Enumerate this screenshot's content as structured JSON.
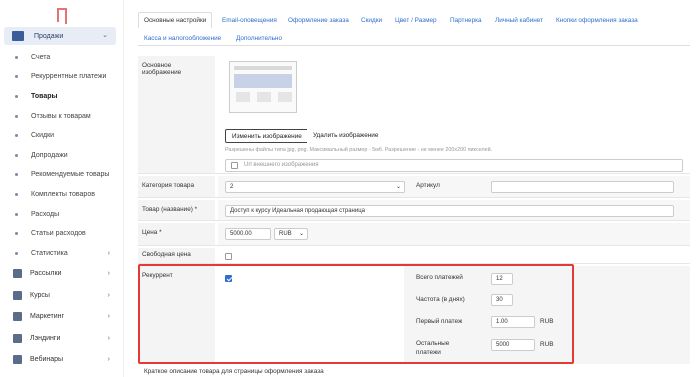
{
  "sidebar": {
    "main_item": {
      "label": "Продажи",
      "icon": "cart-icon"
    },
    "sub_items": [
      {
        "label": "Счета",
        "active": false
      },
      {
        "label": "Рекуррентные платежи",
        "active": false
      },
      {
        "label": "Товары",
        "active": true
      },
      {
        "label": "Отзывы к товарам",
        "active": false
      },
      {
        "label": "Скидки",
        "active": false
      },
      {
        "label": "Допродажи",
        "active": false
      },
      {
        "label": "Рекомендуемые товары",
        "active": false
      },
      {
        "label": "Комплекты товаров",
        "active": false
      },
      {
        "label": "Расходы",
        "active": false
      },
      {
        "label": "Статьи расходов",
        "active": false
      },
      {
        "label": "Статистика",
        "active": false,
        "expandable": true
      }
    ],
    "groups": [
      {
        "label": "Рассылки",
        "icon": "mail-icon"
      },
      {
        "label": "Курсы",
        "icon": "courses-icon"
      },
      {
        "label": "Маркетинг",
        "icon": "marketing-icon"
      },
      {
        "label": "Лэндинги",
        "icon": "landing-icon"
      },
      {
        "label": "Вебинары",
        "icon": "webinar-icon"
      }
    ]
  },
  "tabs": [
    {
      "label": "Основные настройки"
    },
    {
      "label": "Email-оповещения"
    },
    {
      "label": "Оформление заказа"
    },
    {
      "label": "Скидки"
    },
    {
      "label": "Цвет / Размер"
    },
    {
      "label": "Партнерка"
    },
    {
      "label": "Личный кабинет"
    },
    {
      "label": "Кнопки оформления заказа"
    },
    {
      "label": "Касса и налогообложение"
    },
    {
      "label": "Дополнительно"
    }
  ],
  "form": {
    "image": {
      "label": "Основное изображение",
      "change_button": "Изменить изображение",
      "delete_button": "Удалить изображение",
      "hint": "Разрешены файлы типа jpg, png. Максимальный размер - 5мб. Разрешение - не менее 200х200 пикселей.",
      "url_placeholder": "Url внешнего изображения"
    },
    "category": {
      "label": "Категория товара",
      "value": "2"
    },
    "article": {
      "label": "Артикул",
      "value": ""
    },
    "name": {
      "label": "Товар (название) *",
      "value": "Доступ к курсу Идеальная продающая страница"
    },
    "price": {
      "label": "Цена *",
      "value": "5000.00",
      "currency": "RUB"
    },
    "free_price": {
      "label": "Свободная цена",
      "checked": false
    },
    "recurrent": {
      "label": "Рекуррент",
      "checked": true,
      "total_payments": {
        "label": "Всего платежей",
        "value": "12"
      },
      "frequency": {
        "label": "Частота (в днях)",
        "value": "30"
      },
      "first_payment": {
        "label": "Первый платеж",
        "value": "1.00",
        "unit": "RUB"
      },
      "other_payments": {
        "label": "Остальные платежи",
        "value": "5000",
        "unit": "RUB"
      }
    },
    "short_desc": {
      "label": "Краткое описание товара для страницы оформления заказа"
    }
  },
  "colors": {
    "accent": "#2f6fcc",
    "highlight": "#e53935",
    "sidebar_active": "#e8edf5"
  }
}
